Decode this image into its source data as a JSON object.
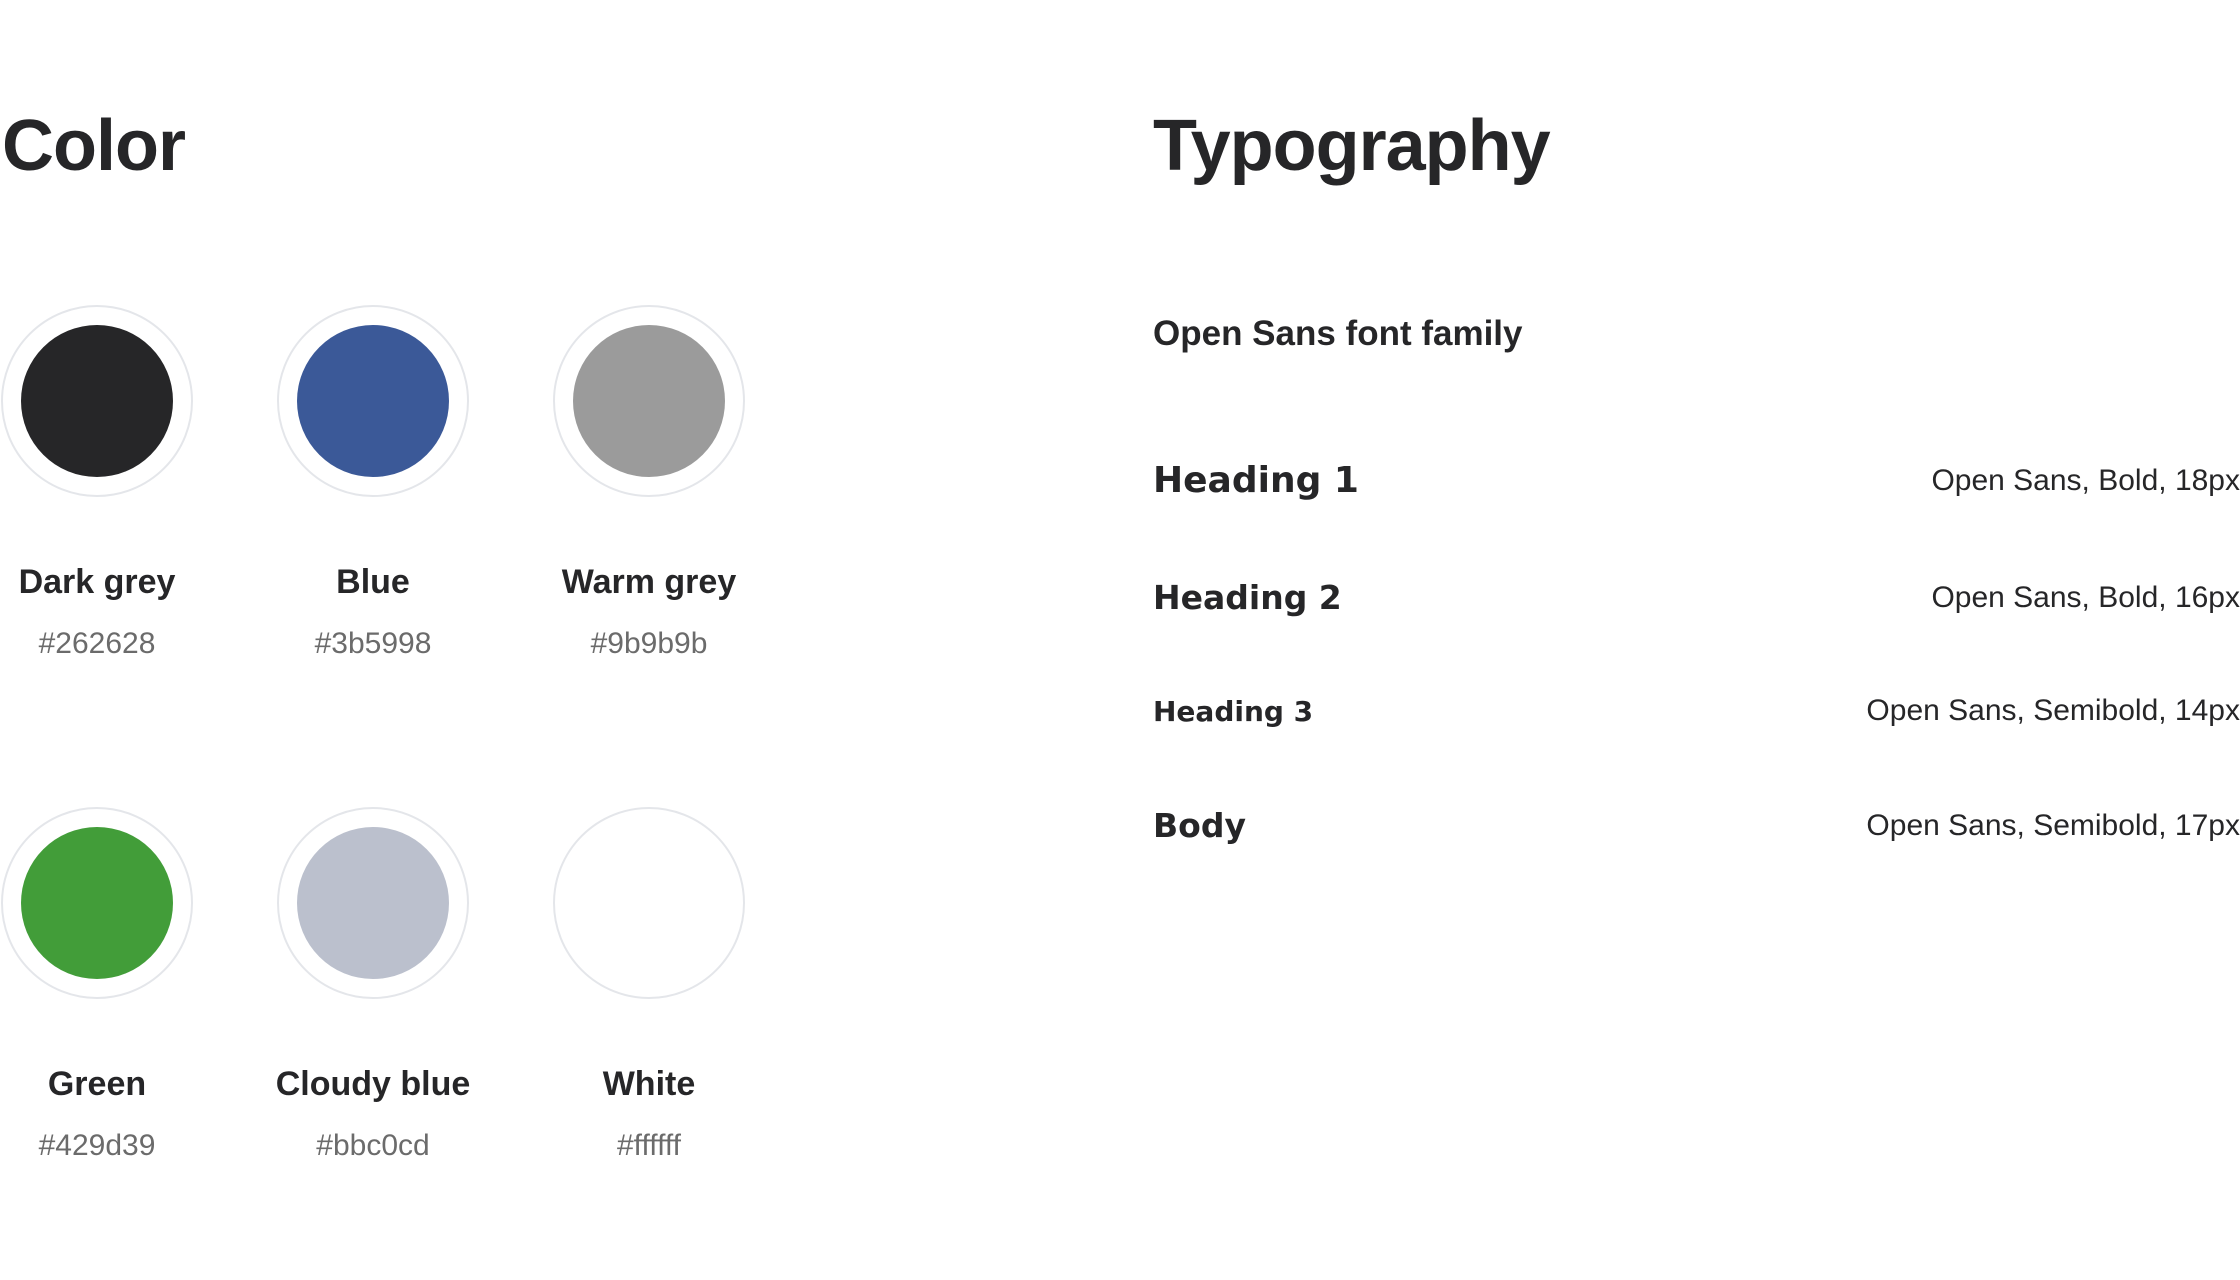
{
  "color_section": {
    "title": "Color",
    "swatches": [
      {
        "name": "Dark grey",
        "hex": "#262628",
        "color": "#262628"
      },
      {
        "name": "Blue",
        "hex": "#3b5998",
        "color": "#3b5998"
      },
      {
        "name": "Warm grey",
        "hex": "#9b9b9b",
        "color": "#9b9b9b"
      },
      {
        "name": "Green",
        "hex": "#429d39",
        "color": "#429d39"
      },
      {
        "name": "Cloudy blue",
        "hex": "#bbc0cd",
        "color": "#bbc0cd"
      },
      {
        "name": "White",
        "hex": "#ffffff",
        "color": "#ffffff"
      }
    ]
  },
  "typography_section": {
    "title": "Typography",
    "family": "Open Sans font family",
    "styles": [
      {
        "name": "Heading 1",
        "spec": "Open Sans, Bold, 18px"
      },
      {
        "name": "Heading 2",
        "spec": "Open Sans, Bold, 16px"
      },
      {
        "name": "Heading 3",
        "spec": "Open Sans, Semibold, 14px"
      },
      {
        "name": "Body",
        "spec": "Open Sans, Semibold, 17px"
      }
    ]
  }
}
